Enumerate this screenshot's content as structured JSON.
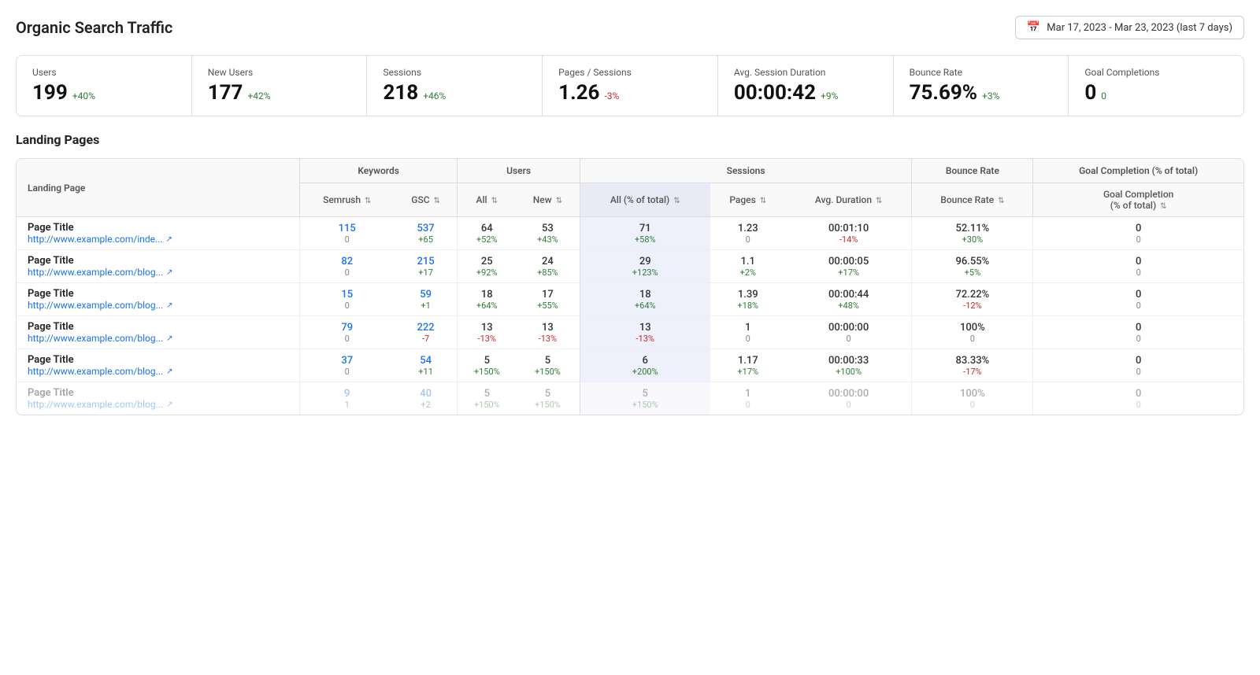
{
  "header": {
    "title": "Organic Search Traffic",
    "dateRange": "Mar 17, 2023 - Mar 23, 2023 (last 7 days)"
  },
  "metrics": [
    {
      "label": "Users",
      "value": "199",
      "delta": "+40%",
      "negative": false
    },
    {
      "label": "New Users",
      "value": "177",
      "delta": "+42%",
      "negative": false
    },
    {
      "label": "Sessions",
      "value": "218",
      "delta": "+46%",
      "negative": false
    },
    {
      "label": "Pages / Sessions",
      "value": "1.26",
      "delta": "-3%",
      "negative": true
    },
    {
      "label": "Avg. Session Duration",
      "value": "00:00:42",
      "delta": "+9%",
      "negative": false
    },
    {
      "label": "Bounce Rate",
      "value": "75.69%",
      "delta": "+3%",
      "negative": false
    },
    {
      "label": "Goal Completions",
      "value": "0",
      "delta": "0",
      "negative": false
    }
  ],
  "section": {
    "title": "Landing Pages"
  },
  "tableHeaders": {
    "landingPage": "Landing Page",
    "keywords": "Keywords",
    "users": "Users",
    "sessions": "Sessions",
    "bounceRate": "Bounce Rate",
    "goalCompletion": "Goal Completion (% of total)"
  },
  "subHeaders": [
    {
      "label": "Semrush",
      "sortable": true
    },
    {
      "label": "GSC",
      "sortable": true
    },
    {
      "label": "All",
      "sortable": true
    },
    {
      "label": "New",
      "sortable": true
    },
    {
      "label": "All (% of total)",
      "sortable": true,
      "highlight": true
    },
    {
      "label": "Pages",
      "sortable": true
    },
    {
      "label": "Avg. Duration",
      "sortable": true
    },
    {
      "label": "Bounce Rate",
      "sortable": true
    },
    {
      "label": "Goal Completion (% of total)",
      "sortable": true
    }
  ],
  "rows": [
    {
      "pageTitle": "Page Title",
      "pageUrl": "http://www.example.com/inde...",
      "semrush": "115",
      "semrushDelta": "0",
      "gsc": "537",
      "gscDelta": "+65",
      "usersAll": "64",
      "usersAllDelta": "+52%",
      "usersNew": "53",
      "usersNewDelta": "+43%",
      "sessionsAll": "71",
      "sessionsAllDelta": "+58%",
      "highlighted": true,
      "pages": "1.23",
      "pagesDelta": "0",
      "avgDuration": "00:01:10",
      "avgDurationDelta": "-14%",
      "bounceRate": "52.11%",
      "bounceRateDelta": "+30%",
      "goalCompletion": "0",
      "goalCompletionDelta": "0",
      "faded": false
    },
    {
      "pageTitle": "Page Title",
      "pageUrl": "http://www.example.com/blog...",
      "semrush": "82",
      "semrushDelta": "0",
      "gsc": "215",
      "gscDelta": "+17",
      "usersAll": "25",
      "usersAllDelta": "+92%",
      "usersNew": "24",
      "usersNewDelta": "+85%",
      "sessionsAll": "29",
      "sessionsAllDelta": "+123%",
      "highlighted": true,
      "pages": "1.1",
      "pagesDelta": "+2%",
      "avgDuration": "00:00:05",
      "avgDurationDelta": "+17%",
      "bounceRate": "96.55%",
      "bounceRateDelta": "+5%",
      "goalCompletion": "0",
      "goalCompletionDelta": "0",
      "faded": false
    },
    {
      "pageTitle": "Page Title",
      "pageUrl": "http://www.example.com/blog...",
      "semrush": "15",
      "semrushDelta": "0",
      "gsc": "59",
      "gscDelta": "+1",
      "usersAll": "18",
      "usersAllDelta": "+64%",
      "usersNew": "17",
      "usersNewDelta": "+55%",
      "sessionsAll": "18",
      "sessionsAllDelta": "+64%",
      "highlighted": true,
      "pages": "1.39",
      "pagesDelta": "+18%",
      "avgDuration": "00:00:44",
      "avgDurationDelta": "+48%",
      "bounceRate": "72.22%",
      "bounceRateDelta": "-12%",
      "goalCompletion": "0",
      "goalCompletionDelta": "0",
      "faded": false
    },
    {
      "pageTitle": "Page Title",
      "pageUrl": "http://www.example.com/blog...",
      "semrush": "79",
      "semrushDelta": "0",
      "gsc": "222",
      "gscDelta": "-7",
      "usersAll": "13",
      "usersAllDelta": "-13%",
      "usersNew": "13",
      "usersNewDelta": "-13%",
      "sessionsAll": "13",
      "sessionsAllDelta": "-13%",
      "highlighted": true,
      "pages": "1",
      "pagesDelta": "0",
      "avgDuration": "00:00:00",
      "avgDurationDelta": "0",
      "bounceRate": "100%",
      "bounceRateDelta": "0",
      "goalCompletion": "0",
      "goalCompletionDelta": "0",
      "faded": false
    },
    {
      "pageTitle": "Page Title",
      "pageUrl": "http://www.example.com/blog...",
      "semrush": "37",
      "semrushDelta": "0",
      "gsc": "54",
      "gscDelta": "+11",
      "usersAll": "5",
      "usersAllDelta": "+150%",
      "usersNew": "5",
      "usersNewDelta": "+150%",
      "sessionsAll": "6",
      "sessionsAllDelta": "+200%",
      "highlighted": true,
      "pages": "1.17",
      "pagesDelta": "+17%",
      "avgDuration": "00:00:33",
      "avgDurationDelta": "+100%",
      "bounceRate": "83.33%",
      "bounceRateDelta": "-17%",
      "goalCompletion": "0",
      "goalCompletionDelta": "0",
      "faded": false
    },
    {
      "pageTitle": "Page Title",
      "pageUrl": "http://www.example.com/blog...",
      "semrush": "9",
      "semrushDelta": "1",
      "gsc": "40",
      "gscDelta": "+2",
      "usersAll": "5",
      "usersAllDelta": "+150%",
      "usersNew": "5",
      "usersNewDelta": "+150%",
      "sessionsAll": "5",
      "sessionsAllDelta": "+150%",
      "highlighted": true,
      "pages": "1",
      "pagesDelta": "0",
      "avgDuration": "00:00:00",
      "avgDurationDelta": "0",
      "bounceRate": "100%",
      "bounceRateDelta": "0",
      "goalCompletion": "0",
      "goalCompletionDelta": "0",
      "faded": true
    }
  ]
}
